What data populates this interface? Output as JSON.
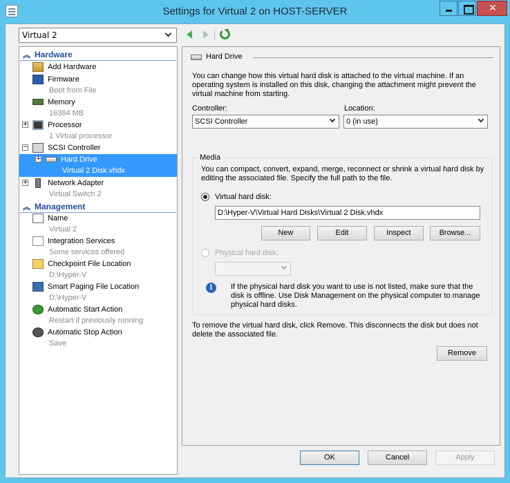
{
  "window": {
    "title": "Settings for Virtual 2 on HOST-SERVER"
  },
  "vm_selector": {
    "value": "Virtual 2"
  },
  "tree": {
    "hardware_header": "Hardware",
    "management_header": "Management",
    "hardware_items": [
      {
        "label": "Add Hardware",
        "sub": ""
      },
      {
        "label": "Firmware",
        "sub": "Boot from File"
      },
      {
        "label": "Memory",
        "sub": "16384 MB"
      },
      {
        "label": "Processor",
        "sub": "1 Virtual processor"
      },
      {
        "label": "SCSI Controller",
        "sub": ""
      },
      {
        "label": "Hard Drive",
        "sub": "Virtual 2 Disk.vhdx"
      },
      {
        "label": "Network Adapter",
        "sub": "Virtual Switch 2"
      }
    ],
    "management_items": [
      {
        "label": "Name",
        "sub": "Virtual 2"
      },
      {
        "label": "Integration Services",
        "sub": "Some services offered"
      },
      {
        "label": "Checkpoint File Location",
        "sub": "D:\\Hyper-V"
      },
      {
        "label": "Smart Paging File Location",
        "sub": "D:\\Hyper-V"
      },
      {
        "label": "Automatic Start Action",
        "sub": "Restart if previously running"
      },
      {
        "label": "Automatic Stop Action",
        "sub": "Save"
      }
    ],
    "expander_plus": "+",
    "expander_minus": "−"
  },
  "panel": {
    "title": "Hard Drive",
    "intro": "You can change how this virtual hard disk is attached to the virtual machine. If an operating system is installed on this disk, changing the attachment might prevent the virtual machine from starting.",
    "controller_label": "Controller:",
    "controller_value": "SCSI Controller",
    "location_label": "Location:",
    "location_value": "0 (in use)",
    "media_legend": "Media",
    "media_desc": "You can compact, convert, expand, merge, reconnect or shrink a virtual hard disk by editing the associated file. Specify the full path to the file.",
    "vhd_radio_label": "Virtual hard disk:",
    "vhd_path": "D:\\Hyper-V\\Virtual Hard Disks\\Virtual 2 Disk.vhdx",
    "buttons": {
      "new": "New",
      "edit": "Edit",
      "inspect": "Inspect",
      "browse": "Browse..."
    },
    "phys_radio_label": "Physical hard disk:",
    "info_icon_glyph": "i",
    "info_text": "If the physical hard disk you want to use is not listed, make sure that the disk is offline. Use Disk Management on the physical computer to manage physical hard disks.",
    "remove_text": "To remove the virtual hard disk, click Remove. This disconnects the disk but does not delete the associated file.",
    "remove_button": "Remove"
  },
  "footer": {
    "ok": "OK",
    "cancel": "Cancel",
    "apply": "Apply"
  },
  "colors": {
    "titlebar": "#5ec5ec",
    "selection": "#3399ff",
    "section_header": "#1e4f9c",
    "close": "#c75050"
  }
}
